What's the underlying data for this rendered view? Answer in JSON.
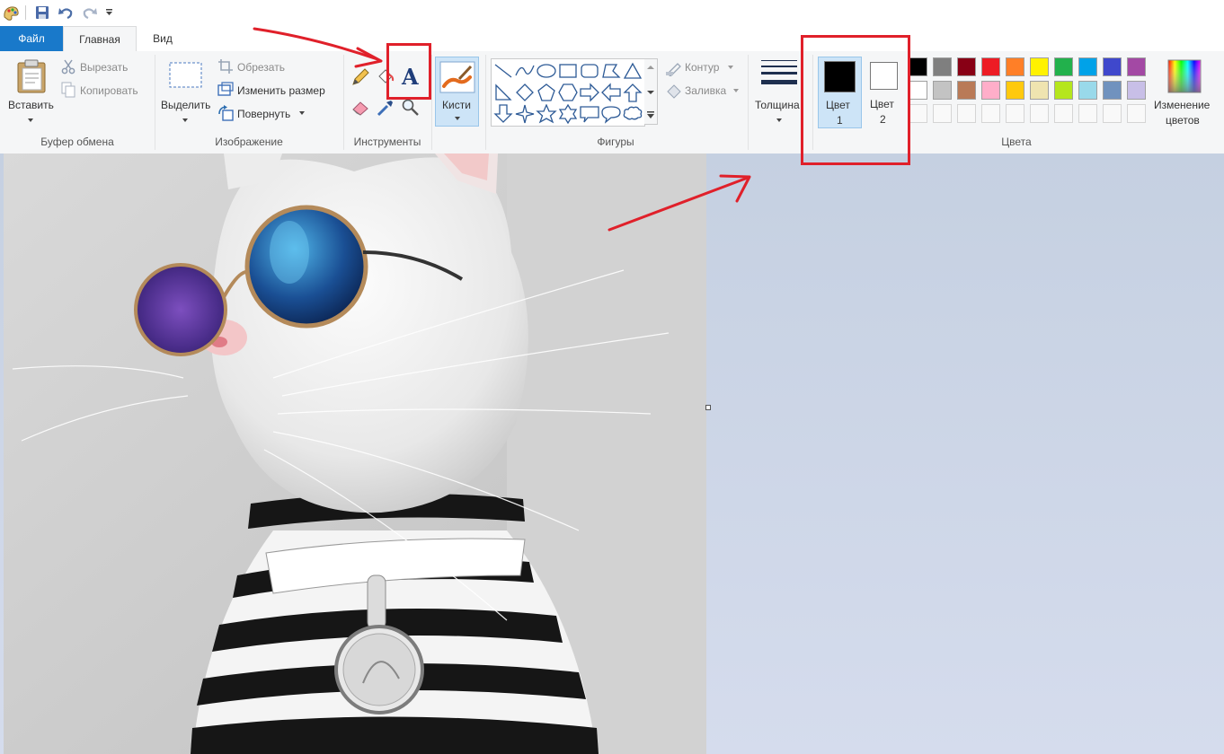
{
  "tabs": {
    "file": "Файл",
    "home": "Главная",
    "view": "Вид"
  },
  "clipboard": {
    "paste": "Вставить",
    "cut": "Вырезать",
    "copy": "Копировать",
    "group": "Буфер обмена"
  },
  "image": {
    "select": "Выделить",
    "crop": "Обрезать",
    "resize": "Изменить размер",
    "rotate": "Повернуть",
    "group": "Изображение"
  },
  "tools": {
    "group": "Инструменты"
  },
  "brushes": {
    "label": "Кисти"
  },
  "shapes": {
    "outline": "Контур",
    "fill": "Заливка",
    "group": "Фигуры"
  },
  "size": {
    "label": "Толщина"
  },
  "colors": {
    "color1_line1": "Цвет",
    "color1_line2": "1",
    "color2_line1": "Цвет",
    "color2_line2": "2",
    "edit_line1": "Изменение",
    "edit_line2": "цветов",
    "group": "Цвета",
    "color1_value": "#000000",
    "color2_value": "#ffffff",
    "palette_row1": [
      "#000000",
      "#7f7f7f",
      "#880015",
      "#ed1c24",
      "#ff7f27",
      "#fff200",
      "#22b14c",
      "#00a2e8",
      "#3f48cc",
      "#a349a4"
    ],
    "palette_row2": [
      "#ffffff",
      "#c3c3c3",
      "#b97a57",
      "#ffaec9",
      "#ffc90e",
      "#efe4b0",
      "#b5e61d",
      "#99d9ea",
      "#7092be",
      "#c8bfe7"
    ]
  },
  "annotation_color": "#e0202a"
}
